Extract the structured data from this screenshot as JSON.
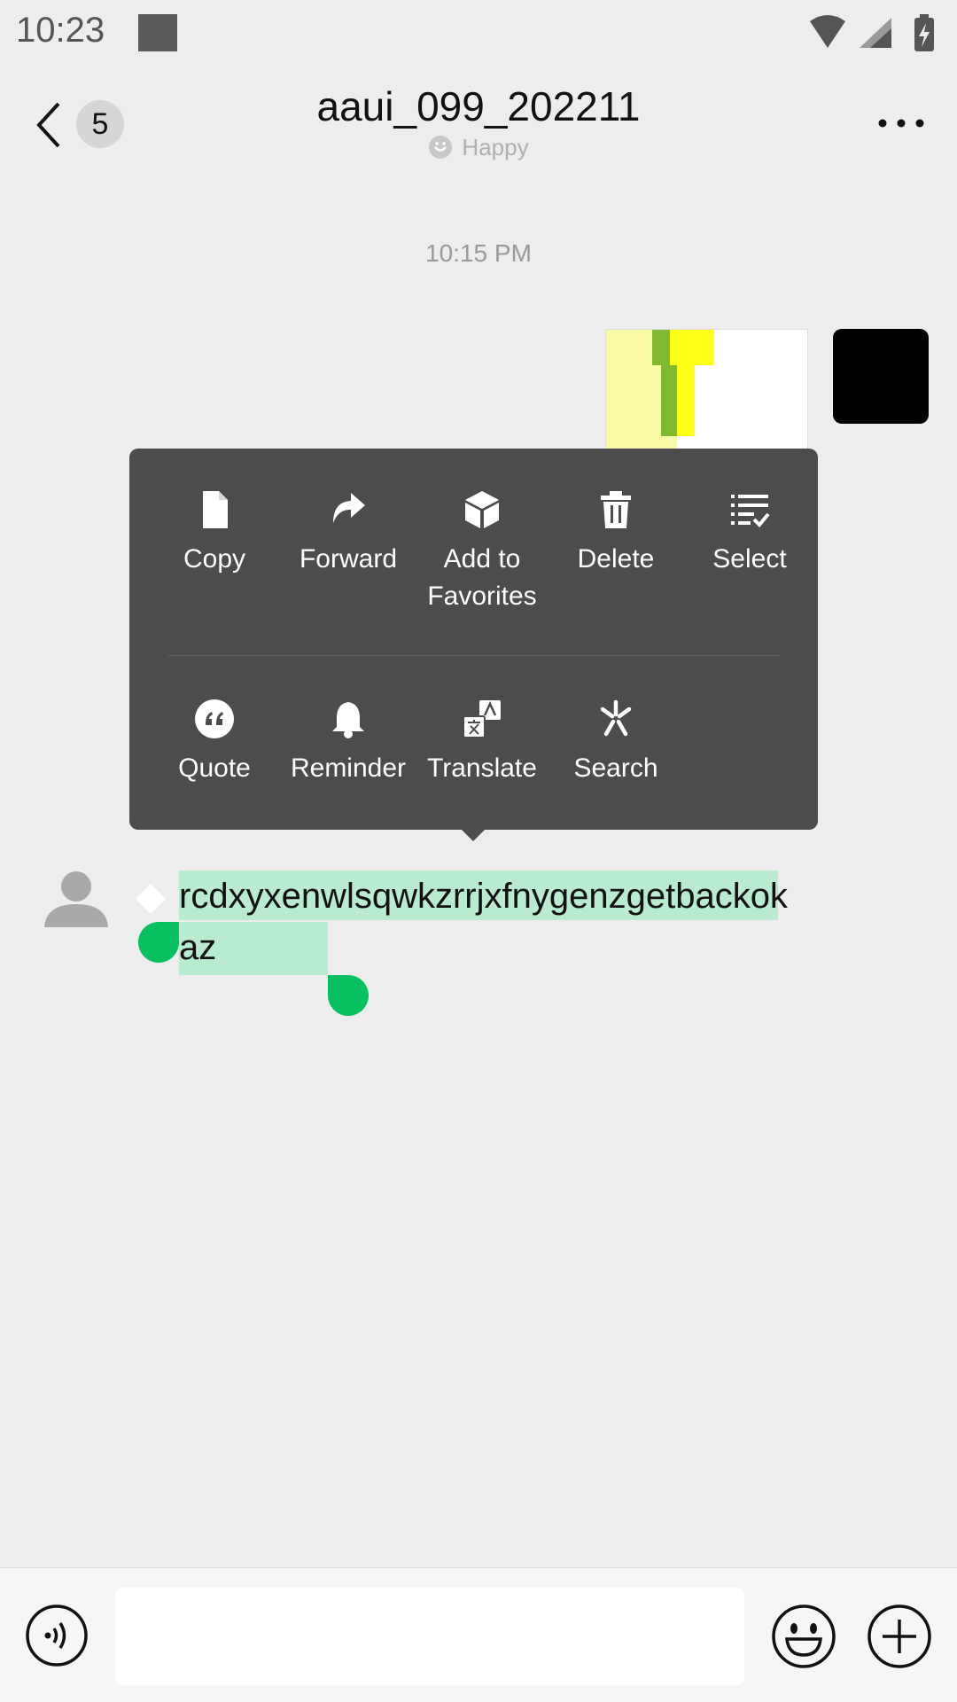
{
  "status_bar": {
    "time": "10:23",
    "icons": [
      "wifi-icon",
      "signal-icon",
      "battery-charging-icon"
    ]
  },
  "header": {
    "unread_count": "5",
    "title": "aaui_099_202211",
    "status_text": "Happy",
    "icons": [
      "back-arrow-icon",
      "mood-icon",
      "more-icon"
    ]
  },
  "chat": {
    "timestamp": "10:15 PM",
    "received_message": "rcdxyxenwlsqwkzrrjxfnygenzgetbackokaz",
    "selection_color": "#b8ebcf",
    "handle_color": "#07c160"
  },
  "context_menu": {
    "row1": [
      {
        "label": "Copy",
        "icon": "copy-icon"
      },
      {
        "label": "Forward",
        "icon": "forward-icon"
      },
      {
        "label": "Add to Favorites",
        "icon": "favorites-cube-icon"
      },
      {
        "label": "Delete",
        "icon": "trash-icon"
      },
      {
        "label": "Select",
        "icon": "multi-select-icon"
      }
    ],
    "row2": [
      {
        "label": "Quote",
        "icon": "quote-icon"
      },
      {
        "label": "Reminder",
        "icon": "bell-icon"
      },
      {
        "label": "Translate",
        "icon": "translate-icon"
      },
      {
        "label": "Search",
        "icon": "search-spark-icon"
      }
    ],
    "background": "#4c4c4c"
  },
  "input_bar": {
    "value": "",
    "icons": [
      "voice-icon",
      "emoji-icon",
      "plus-icon"
    ]
  }
}
